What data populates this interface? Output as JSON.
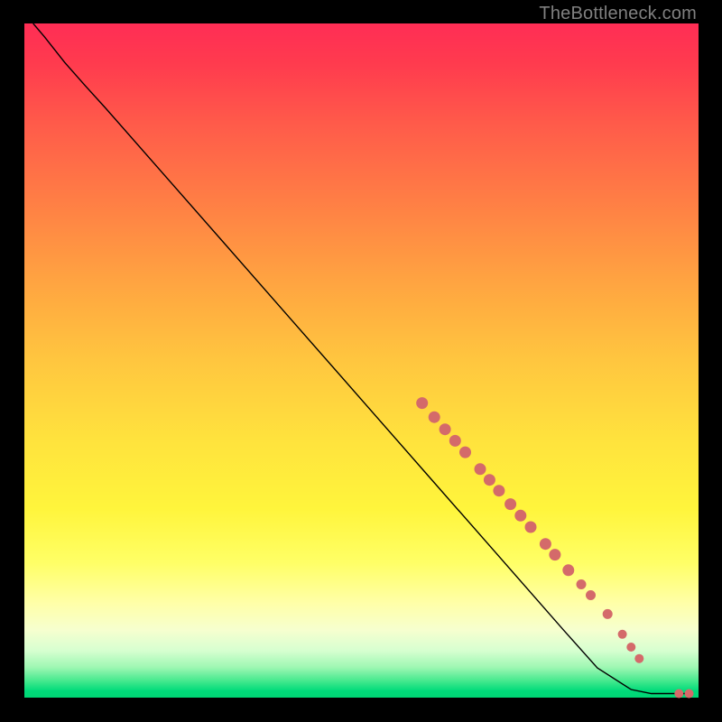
{
  "watermark": "TheBottleneck.com",
  "colors": {
    "background": "#000000",
    "curve": "#000000",
    "points": "#d46a6a",
    "gradient_top": "#ff2d55",
    "gradient_bottom": "#00d574"
  },
  "chart_data": {
    "type": "line",
    "title": "",
    "xlabel": "",
    "ylabel": "",
    "xlim": [
      0,
      100
    ],
    "ylim": [
      0,
      100
    ],
    "curve": [
      {
        "x": 1.3,
        "y": 100.0
      },
      {
        "x": 3.0,
        "y": 98.0
      },
      {
        "x": 6.0,
        "y": 94.2
      },
      {
        "x": 9.0,
        "y": 90.8
      },
      {
        "x": 12.0,
        "y": 87.5
      },
      {
        "x": 20.0,
        "y": 78.4
      },
      {
        "x": 30.0,
        "y": 67.0
      },
      {
        "x": 40.0,
        "y": 55.6
      },
      {
        "x": 50.0,
        "y": 44.2
      },
      {
        "x": 60.0,
        "y": 32.8
      },
      {
        "x": 70.0,
        "y": 21.4
      },
      {
        "x": 80.0,
        "y": 10.0
      },
      {
        "x": 85.0,
        "y": 4.4
      },
      {
        "x": 90.0,
        "y": 1.2
      },
      {
        "x": 93.0,
        "y": 0.6
      },
      {
        "x": 96.0,
        "y": 0.6
      },
      {
        "x": 98.5,
        "y": 0.6
      }
    ],
    "points": [
      {
        "x": 59.0,
        "y": 43.7,
        "r": 6.5
      },
      {
        "x": 60.8,
        "y": 41.6,
        "r": 6.5
      },
      {
        "x": 62.4,
        "y": 39.8,
        "r": 6.5
      },
      {
        "x": 63.9,
        "y": 38.1,
        "r": 6.5
      },
      {
        "x": 65.4,
        "y": 36.4,
        "r": 6.5
      },
      {
        "x": 67.6,
        "y": 33.9,
        "r": 6.5
      },
      {
        "x": 69.0,
        "y": 32.3,
        "r": 6.5
      },
      {
        "x": 70.4,
        "y": 30.7,
        "r": 6.5
      },
      {
        "x": 72.1,
        "y": 28.7,
        "r": 6.5
      },
      {
        "x": 73.6,
        "y": 27.0,
        "r": 6.5
      },
      {
        "x": 75.1,
        "y": 25.3,
        "r": 6.5
      },
      {
        "x": 77.3,
        "y": 22.8,
        "r": 6.5
      },
      {
        "x": 78.7,
        "y": 21.2,
        "r": 6.5
      },
      {
        "x": 80.7,
        "y": 18.9,
        "r": 6.5
      },
      {
        "x": 82.6,
        "y": 16.8,
        "r": 5.5
      },
      {
        "x": 84.0,
        "y": 15.2,
        "r": 5.5
      },
      {
        "x": 86.5,
        "y": 12.4,
        "r": 5.5
      },
      {
        "x": 88.7,
        "y": 9.4,
        "r": 5.0
      },
      {
        "x": 90.0,
        "y": 7.5,
        "r": 5.0
      },
      {
        "x": 91.2,
        "y": 5.8,
        "r": 5.0
      },
      {
        "x": 97.1,
        "y": 0.6,
        "r": 5.0
      },
      {
        "x": 98.6,
        "y": 0.6,
        "r": 5.0
      }
    ]
  }
}
